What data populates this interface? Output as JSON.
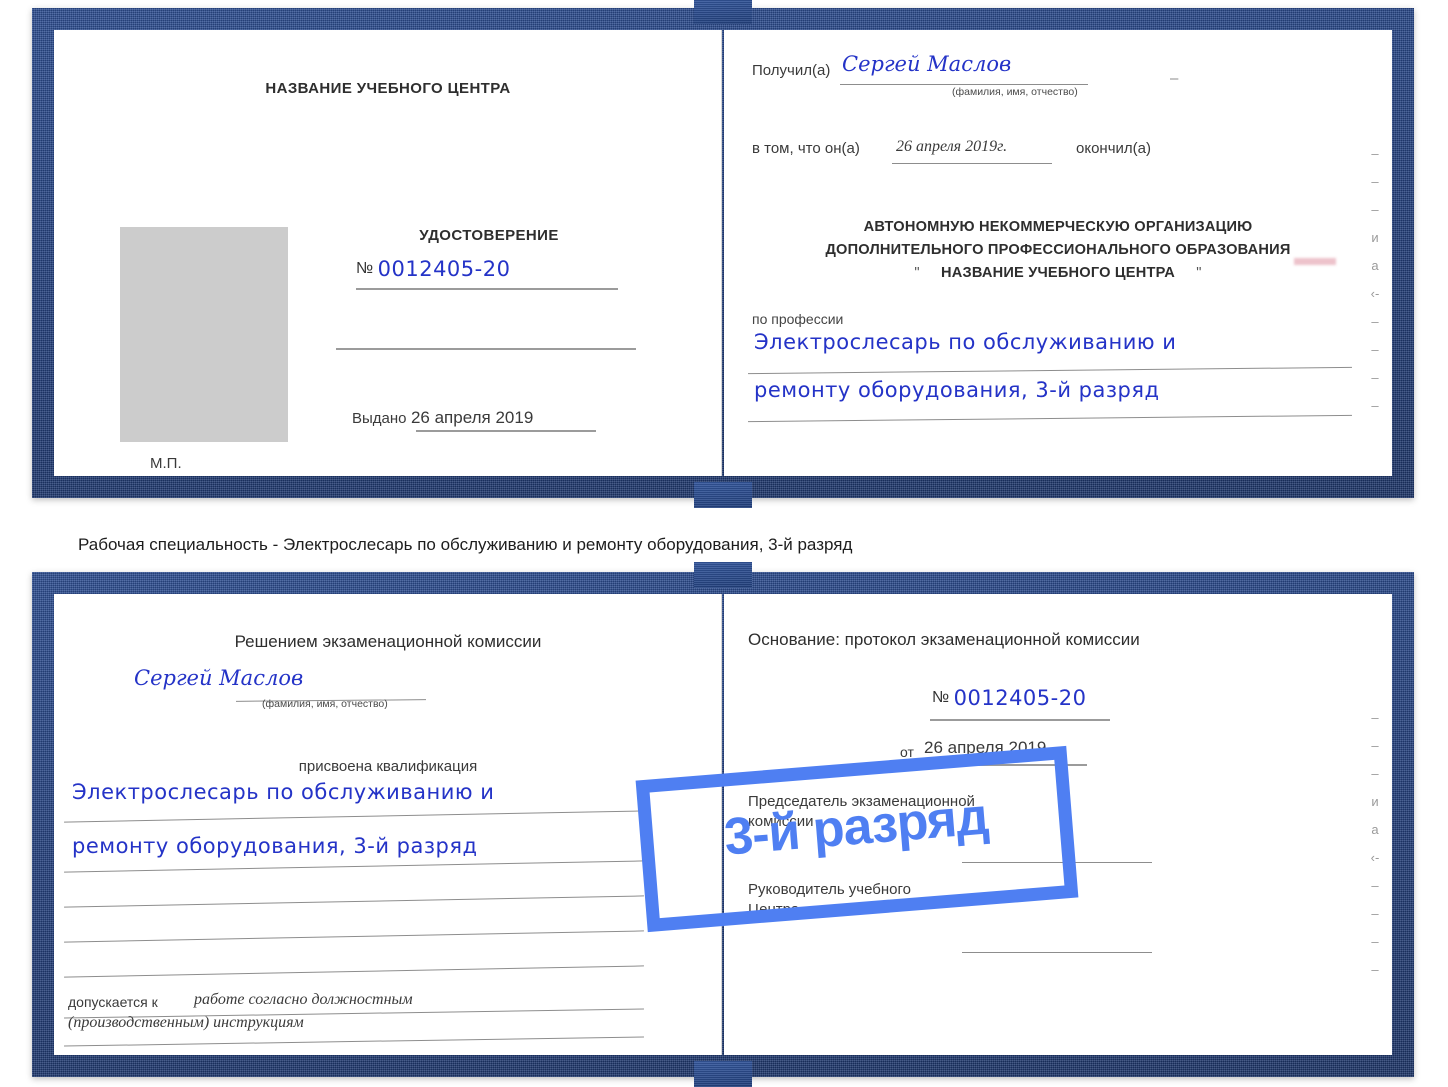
{
  "caption": {
    "text": "Рабочая специальность - Электрослесарь по обслуживанию и ремонту оборудования, 3-й разряд"
  },
  "rank_badge": {
    "label": "3-й разряд",
    "color": "#4f7ff2"
  },
  "colors": {
    "cover": "#24417f",
    "handwriting": "#2433c7",
    "photo_placeholder": "#cccccc",
    "rule": "#8d8d8d"
  },
  "certificate_top": {
    "left_page": {
      "center_title": "НАЗВАНИЕ УЧЕБНОГО ЦЕНТРА",
      "photo_placeholder": "",
      "stamp_label": "М.П.",
      "document_type": "УДОСТОВЕРЕНИЕ",
      "number_symbol": "№",
      "number_value": "0012405-20",
      "issued_label": "Выдано",
      "issued_value": "26 апреля 2019"
    },
    "right_page": {
      "received_label": "Получил(а)",
      "received_name": "Сергей Маслов",
      "fio_hint": "(фамилия, имя, отчество)",
      "in_that_label": "в том, что он(а)",
      "completion_date": "26 апреля 2019г.",
      "finished_label": "окончил(а)",
      "organization_line1": "АВТОНОМНУЮ НЕКОММЕРЧЕСКУЮ ОРГАНИЗАЦИЮ",
      "organization_line2": "ДОПОЛНИТЕЛЬНОГО ПРОФЕССИОНАЛЬНОГО ОБРАЗОВАНИЯ",
      "organization_quote_open": "\"",
      "organization_name": "НАЗВАНИЕ УЧЕБНОГО ЦЕНТРА",
      "organization_quote_close": "\"",
      "profession_label": "по профессии",
      "profession_line1": "Электрослесарь по обслуживанию и",
      "profession_line2": "ремонту оборудования, 3-й разряд",
      "edge_marks": [
        "–",
        "–",
        "–",
        "и",
        "а",
        "‹-",
        "–",
        "–",
        "–",
        "–"
      ]
    }
  },
  "certificate_bottom": {
    "left_page": {
      "heading": "Решением экзаменационной комиссии",
      "name": "Сергей Маслов",
      "fio_hint": "(фамилия, имя, отчество)",
      "qualification_label": "присвоена квалификация",
      "qualification_line1": "Электрослесарь по обслуживанию и",
      "qualification_line2": "ремонту оборудования, 3-й разряд",
      "admitted_label": "допускается к",
      "admitted_line1": "работе согласно должностным",
      "admitted_line2": "(производственным) инструкциям"
    },
    "right_page": {
      "basis_label": "Основание: протокол экзаменационной комиссии",
      "number_symbol": "№",
      "number_value": "0012405-20",
      "from_label": "от",
      "from_date": "26 апреля 2019",
      "chairman_line1": "Председатель экзаменационной",
      "chairman_line2": "комиссии",
      "director_line1": "Руководитель учебного",
      "director_line2": "Центра",
      "edge_marks": [
        "–",
        "–",
        "–",
        "и",
        "а",
        "‹-",
        "–",
        "–",
        "–",
        "–"
      ]
    }
  }
}
